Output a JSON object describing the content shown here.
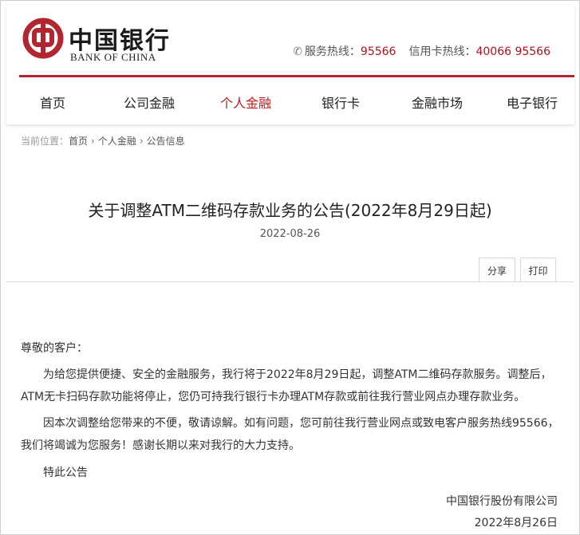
{
  "header": {
    "logo_cn": "中国银行",
    "logo_en": "BANK OF CHINA",
    "hotline_label": "服务热线：",
    "hotline_number": "95566",
    "card_hotline_label": "信用卡热线：",
    "card_hotline_number": "40066 95566",
    "brand_color": "#b3262f"
  },
  "nav": {
    "items": [
      "首页",
      "公司金融",
      "个人金融",
      "银行卡",
      "金融市场",
      "电子银行"
    ],
    "active": "个人金融"
  },
  "breadcrumb": {
    "prefix": "当前位置：",
    "items": [
      "首页",
      "个人金融",
      "公告信息"
    ]
  },
  "article": {
    "title": "关于调整ATM二维码存款业务的公告(2022年8月29日起)",
    "date": "2022-08-26",
    "share_label": "分享",
    "print_label": "打印",
    "greeting": "尊敬的客户：",
    "para1_line1": "为给您提供便捷、安全的金融服务，我行将于2022年8月29日起，调整ATM二维码存款服务。调整后，",
    "para1_line2": "ATM无卡扫码存款功能将停止，您仍可持我行银行卡办理ATM存款或前往我行营业网点办理存款业务。",
    "para2_line1": "因本次调整给您带来的不便，敬请谅解。如有问题，您可前往我行营业网点或致电客户服务热线95566，",
    "para2_line2": "我们将竭诚为您服务！感谢长期以来对我行的大力支持。",
    "closing": "特此公告",
    "signature": "中国银行股份有限公司",
    "sign_date": "2022年8月26日"
  }
}
